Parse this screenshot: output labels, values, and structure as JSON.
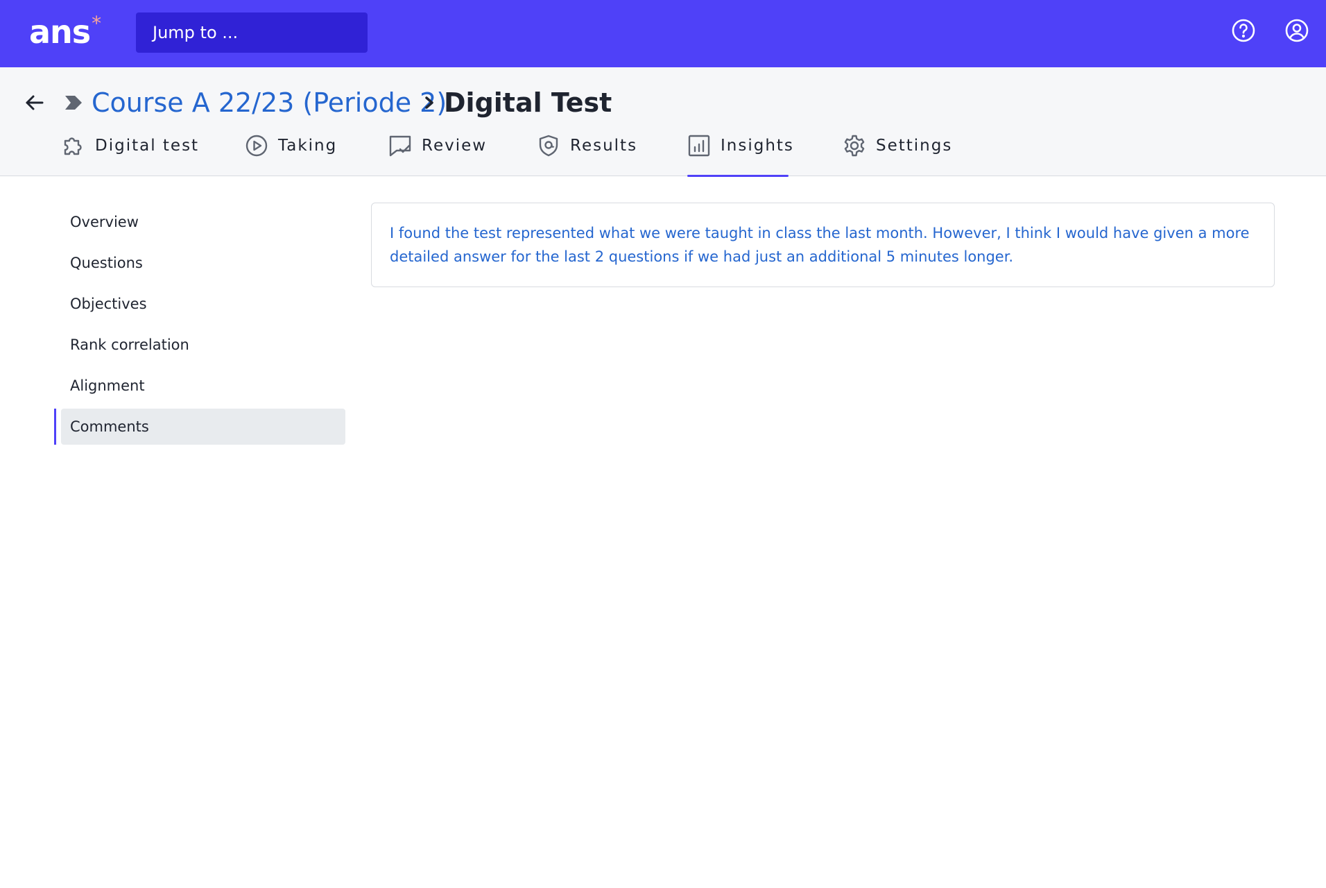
{
  "topbar": {
    "logo_text": "ans",
    "logo_mark": "*",
    "jump_placeholder": "Jump to ...",
    "icons": [
      "help-circle-icon",
      "account-circle-icon"
    ]
  },
  "header": {
    "breadcrumb_course": "Course A 22/23 (Periode 2)",
    "breadcrumb_separator": ">",
    "title": "Digital Test",
    "tabs": [
      {
        "label": "Digital test",
        "icon": "puzzle-icon"
      },
      {
        "label": "Taking",
        "icon": "play-circle-icon"
      },
      {
        "label": "Review",
        "icon": "review-check-icon"
      },
      {
        "label": "Results",
        "icon": "shield-icon"
      },
      {
        "label": "Insights",
        "icon": "bar-chart-icon",
        "active": true
      },
      {
        "label": "Settings",
        "icon": "gear-icon"
      }
    ]
  },
  "sidenav": {
    "items": [
      {
        "label": "Overview"
      },
      {
        "label": "Questions"
      },
      {
        "label": "Objectives"
      },
      {
        "label": "Rank correlation"
      },
      {
        "label": "Alignment"
      },
      {
        "label": "Comments",
        "active": true
      }
    ]
  },
  "comments": [
    {
      "text": "I found the test represented what we were taught in class the last month. However, I think I would have given a more detailed answer for the last 2 questions if we had just an additional 5 minutes longer."
    }
  ],
  "colors": {
    "brand": "#4f41f8",
    "link": "#2566cf",
    "logo_accent": "#f7a59a"
  }
}
